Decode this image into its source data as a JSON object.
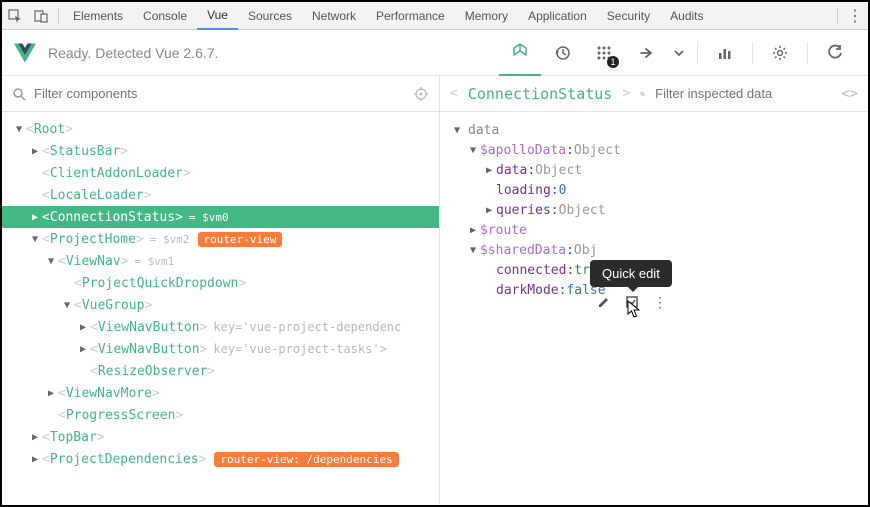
{
  "devtools_tabs": [
    "Elements",
    "Console",
    "Vue",
    "Sources",
    "Network",
    "Performance",
    "Memory",
    "Application",
    "Security",
    "Audits"
  ],
  "devtools_active_tab": 2,
  "vue_status": "Ready. Detected Vue 2.6.7.",
  "vuex_badge": "1",
  "left": {
    "filter_placeholder": "Filter components",
    "tree": [
      {
        "indent": 0,
        "arrow": "▼",
        "name": "Root",
        "selected": false
      },
      {
        "indent": 1,
        "arrow": "▶",
        "name": "StatusBar"
      },
      {
        "indent": 1,
        "arrow": "",
        "name": "ClientAddonLoader"
      },
      {
        "indent": 1,
        "arrow": "",
        "name": "LocaleLoader"
      },
      {
        "indent": 1,
        "arrow": "▶",
        "name": "ConnectionStatus",
        "selected": true,
        "varref": "= $vm0"
      },
      {
        "indent": 1,
        "arrow": "▼",
        "name": "ProjectHome",
        "varref": "= $vm2",
        "router": "router-view"
      },
      {
        "indent": 2,
        "arrow": "▼",
        "name": "ViewNav",
        "varref": "= $vm1"
      },
      {
        "indent": 3,
        "arrow": "",
        "name": "ProjectQuickDropdown"
      },
      {
        "indent": 3,
        "arrow": "▼",
        "name": "VueGroup"
      },
      {
        "indent": 4,
        "arrow": "▶",
        "name": "ViewNavButton",
        "attr_key": "key",
        "attr_val": "'vue-project-dependenc"
      },
      {
        "indent": 4,
        "arrow": "▶",
        "name": "ViewNavButton",
        "attr_key": "key",
        "attr_val": "'vue-project-tasks'"
      },
      {
        "indent": 4,
        "arrow": "",
        "name": "ResizeObserver"
      },
      {
        "indent": 2,
        "arrow": "▶",
        "name": "ViewNavMore"
      },
      {
        "indent": 2,
        "arrow": "",
        "name": "ProgressScreen"
      },
      {
        "indent": 1,
        "arrow": "▶",
        "name": "TopBar"
      },
      {
        "indent": 1,
        "arrow": "▶",
        "name": "ProjectDependencies",
        "router": "router-view: /dependencies"
      }
    ]
  },
  "right": {
    "title": "ConnectionStatus",
    "filter_placeholder": "Filter inspected data",
    "section": "data",
    "rows": [
      {
        "indent": 1,
        "arrow": "▼",
        "key": "$apolloData",
        "type": "Object",
        "special": true
      },
      {
        "indent": 2,
        "arrow": "▶",
        "key": "data",
        "type": "Object"
      },
      {
        "indent": 2,
        "arrow": "",
        "key": "loading",
        "num": "0"
      },
      {
        "indent": 2,
        "arrow": "▶",
        "key": "queries",
        "type": "Object"
      },
      {
        "indent": 1,
        "arrow": "▶",
        "key": "$route",
        "special": true
      },
      {
        "indent": 1,
        "arrow": "▼",
        "key": "$sharedData",
        "type": "Obj",
        "special": true
      },
      {
        "indent": 2,
        "arrow": "",
        "key": "connected",
        "bool": "true"
      },
      {
        "indent": 2,
        "arrow": "",
        "key": "darkMode",
        "bool": "false"
      }
    ]
  },
  "tooltip": "Quick edit"
}
